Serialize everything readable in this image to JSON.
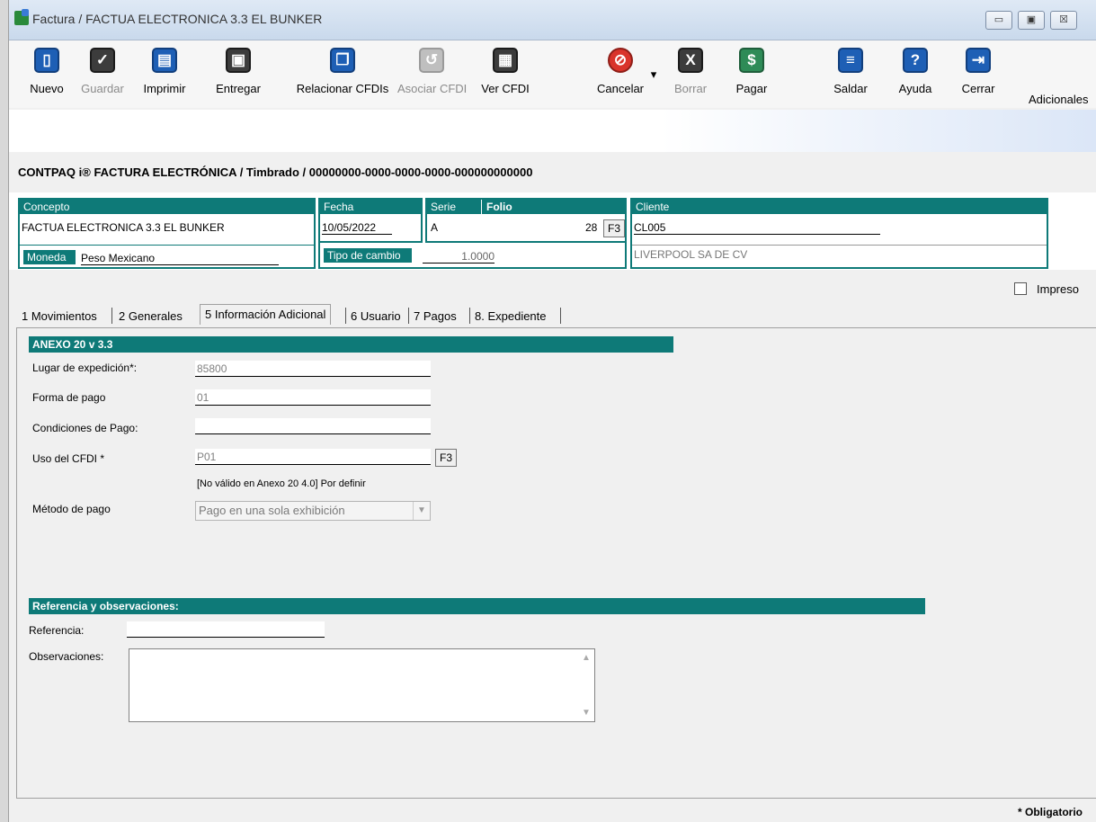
{
  "window": {
    "title": "Factura / FACTUA ELECTRONICA 3.3 EL BUNKER",
    "minimize": "▭",
    "maximize": "▣",
    "close": "☒"
  },
  "toolbar": {
    "nuevo": "Nuevo",
    "guardar": "Guardar",
    "imprimir": "Imprimir",
    "entregar": "Entregar",
    "relacionar": "Relacionar CFDIs",
    "asociar": "Asociar CFDI",
    "ver": "Ver CFDI",
    "cancelar": "Cancelar",
    "borrar": "Borrar",
    "pagar": "Pagar",
    "saldar": "Saldar",
    "ayuda": "Ayuda",
    "cerrar": "Cerrar",
    "adicionales": "Adicionales"
  },
  "doc_title": "CONTPAQ i® FACTURA ELECTRÓNICA / Timbrado / 00000000-0000-0000-0000-000000000000",
  "header": {
    "concepto_label": "Concepto",
    "concepto_value": "FACTUA ELECTRONICA 3.3 EL BUNKER",
    "fecha_label": "Fecha",
    "fecha_value": "10/05/2022",
    "serie_label": "Serie",
    "serie_value": "A",
    "folio_label": "Folio",
    "folio_value": "28",
    "f3": "F3",
    "cliente_label": "Cliente",
    "cliente_code": "CL005",
    "cliente_name": "LIVERPOOL SA DE CV",
    "moneda_label": "Moneda",
    "moneda_value": "Peso Mexicano",
    "tipo_cambio_label": "Tipo de cambio",
    "tipo_cambio_value": "1.0000"
  },
  "impreso_label": "Impreso",
  "tabs": [
    {
      "label": "1 Movimientos"
    },
    {
      "label": "2 Generales"
    },
    {
      "label": "5 Información Adicional"
    },
    {
      "label": "6 Usuario"
    },
    {
      "label": "7 Pagos"
    },
    {
      "label": "8. Expediente"
    }
  ],
  "anexo": {
    "title": "ANEXO 20 v 3.3",
    "lugar_label": "Lugar de expedición*:",
    "lugar_value": "85800",
    "forma_label": "Forma de pago",
    "forma_value": "01",
    "condiciones_label": "Condiciones de Pago:",
    "condiciones_value": "",
    "uso_label": "Uso del CFDI *",
    "uso_value": "P01",
    "uso_note": "[No válido en Anexo 20 4.0] Por definir",
    "metodo_label": "Método de pago",
    "metodo_value": "Pago en una sola exhibición"
  },
  "referencias": {
    "title": "Referencia y observaciones:",
    "referencia_label": "Referencia:",
    "observaciones_label": "Observaciones:"
  },
  "footer_note": "* Obligatorio"
}
